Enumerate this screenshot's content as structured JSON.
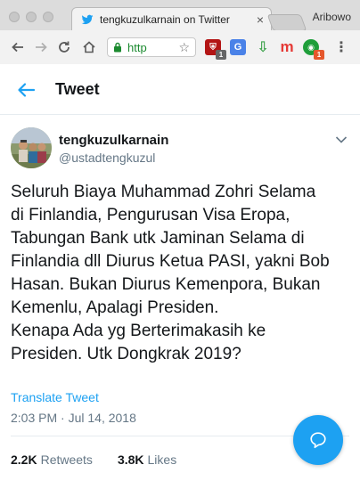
{
  "browser": {
    "tab_title": "tengkuzulkarnain on Twitter",
    "profile_name": "Aribowo",
    "url": "https://twitter.com",
    "url_display": "http",
    "extensions": [
      {
        "name": "extension-shield",
        "color": "#b31515",
        "badge": "1"
      },
      {
        "name": "google-translate",
        "color": "#4a82e8"
      },
      {
        "name": "download-arrow",
        "color": "#3fa34d"
      },
      {
        "name": "m-extension",
        "color": "#e53935",
        "label": "m"
      },
      {
        "name": "green-extension",
        "color": "#1e9e3a",
        "badge": "1"
      }
    ]
  },
  "header": {
    "title": "Tweet"
  },
  "tweet": {
    "author": {
      "display_name": "tengkuzulkarnain",
      "handle": "@ustadtengkuzul"
    },
    "text": "Seluruh Biaya Muhammad Zohri Selama\ndi Finlandia, Pengurusan Visa Eropa,\nTabungan Bank utk Jaminan Selama di\nFinlandia dll Diurus Ketua PASI, yakni Bob\nHasan. Bukan Diurus Kemenpora, Bukan\nKemenlu, Apalagi Presiden.\nKenapa Ada yg Berterimakasih ke\nPresiden. Utk Dongkrak 2019?",
    "translate_label": "Translate Tweet",
    "timestamp": "2:03 PM · Jul 14, 2018",
    "retweets_count": "2.2K",
    "retweets_label": "Retweets",
    "likes_count": "3.8K",
    "likes_label": "Likes"
  },
  "colors": {
    "accent": "#1da1f2",
    "secondary_text": "#657786",
    "primary_text": "#14171a"
  }
}
